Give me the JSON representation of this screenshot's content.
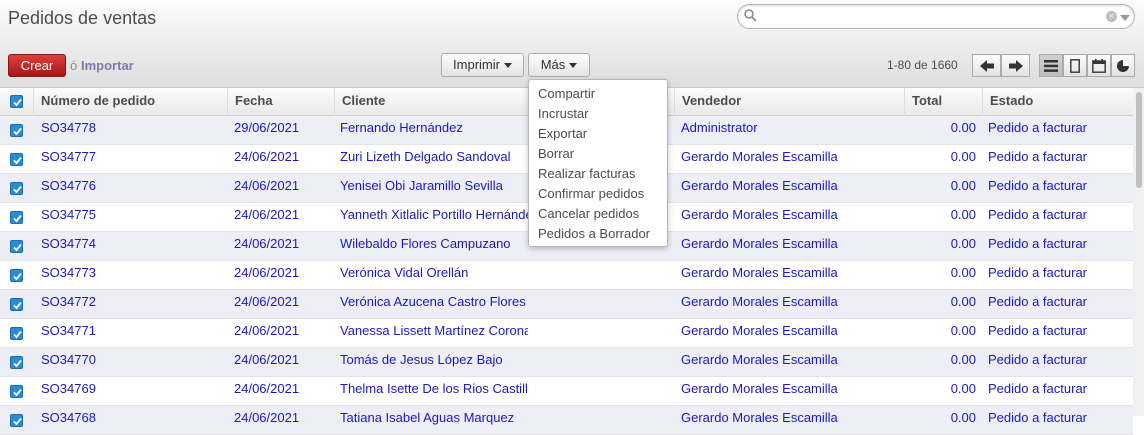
{
  "header": {
    "title": "Pedidos de ventas",
    "search_placeholder": "",
    "search_value": ""
  },
  "toolbar": {
    "create_label": "Crear",
    "or_label": "ó",
    "import_label": "Importar",
    "print_label": "Imprimir",
    "more_label": "Más",
    "pager_text": "1-80 de 1660"
  },
  "more_menu": {
    "items": [
      "Compartir",
      "Incrustar",
      "Exportar",
      "Borrar",
      "Realizar facturas",
      "Confirmar pedidos",
      "Cancelar pedidos",
      "Pedidos a Borrador"
    ]
  },
  "table": {
    "columns": {
      "order": "Número de pedido",
      "date": "Fecha",
      "customer": "Cliente",
      "salesperson": "Vendedor",
      "total": "Total",
      "state": "Estado"
    },
    "rows": [
      {
        "order": "SO34778",
        "date": "29/06/2021",
        "customer": "Fernando Hernández",
        "salesperson": "Administrator",
        "total": "0.00",
        "state": "Pedido a facturar"
      },
      {
        "order": "SO34777",
        "date": "24/06/2021",
        "customer": "Zuri Lizeth Delgado Sandoval",
        "salesperson": "Gerardo Morales Escamilla",
        "total": "0.00",
        "state": "Pedido a facturar"
      },
      {
        "order": "SO34776",
        "date": "24/06/2021",
        "customer": "Yenisei Obi Jaramillo Sevilla",
        "salesperson": "Gerardo Morales Escamilla",
        "total": "0.00",
        "state": "Pedido a facturar"
      },
      {
        "order": "SO34775",
        "date": "24/06/2021",
        "customer": "Yanneth Xitlalic Portillo Hernández",
        "salesperson": "Gerardo Morales Escamilla",
        "total": "0.00",
        "state": "Pedido a facturar"
      },
      {
        "order": "SO34774",
        "date": "24/06/2021",
        "customer": "Wilebaldo Flores Campuzano",
        "salesperson": "Gerardo Morales Escamilla",
        "total": "0.00",
        "state": "Pedido a facturar"
      },
      {
        "order": "SO34773",
        "date": "24/06/2021",
        "customer": "Verónica Vidal Orellán",
        "salesperson": "Gerardo Morales Escamilla",
        "total": "0.00",
        "state": "Pedido a facturar"
      },
      {
        "order": "SO34772",
        "date": "24/06/2021",
        "customer": "Verónica Azucena Castro Flores",
        "salesperson": "Gerardo Morales Escamilla",
        "total": "0.00",
        "state": "Pedido a facturar"
      },
      {
        "order": "SO34771",
        "date": "24/06/2021",
        "customer": "Vanessa Lissett Martínez Coronado",
        "salesperson": "Gerardo Morales Escamilla",
        "total": "0.00",
        "state": "Pedido a facturar"
      },
      {
        "order": "SO34770",
        "date": "24/06/2021",
        "customer": "Tomás de Jesus López Bajo",
        "salesperson": "Gerardo Morales Escamilla",
        "total": "0.00",
        "state": "Pedido a facturar"
      },
      {
        "order": "SO34769",
        "date": "24/06/2021",
        "customer": "Thelma Isette De los Rios Castillo",
        "salesperson": "Gerardo Morales Escamilla",
        "total": "0.00",
        "state": "Pedido a facturar"
      },
      {
        "order": "SO34768",
        "date": "24/06/2021",
        "customer": "Tatiana Isabel Aguas Marquez",
        "salesperson": "Gerardo Morales Escamilla",
        "total": "0.00",
        "state": "Pedido a facturar"
      }
    ]
  },
  "colors": {
    "link": "#1a1ab9",
    "create_button": "#c42424",
    "checkbox": "#2a8bd6",
    "odd_row": "#eeeef7"
  }
}
